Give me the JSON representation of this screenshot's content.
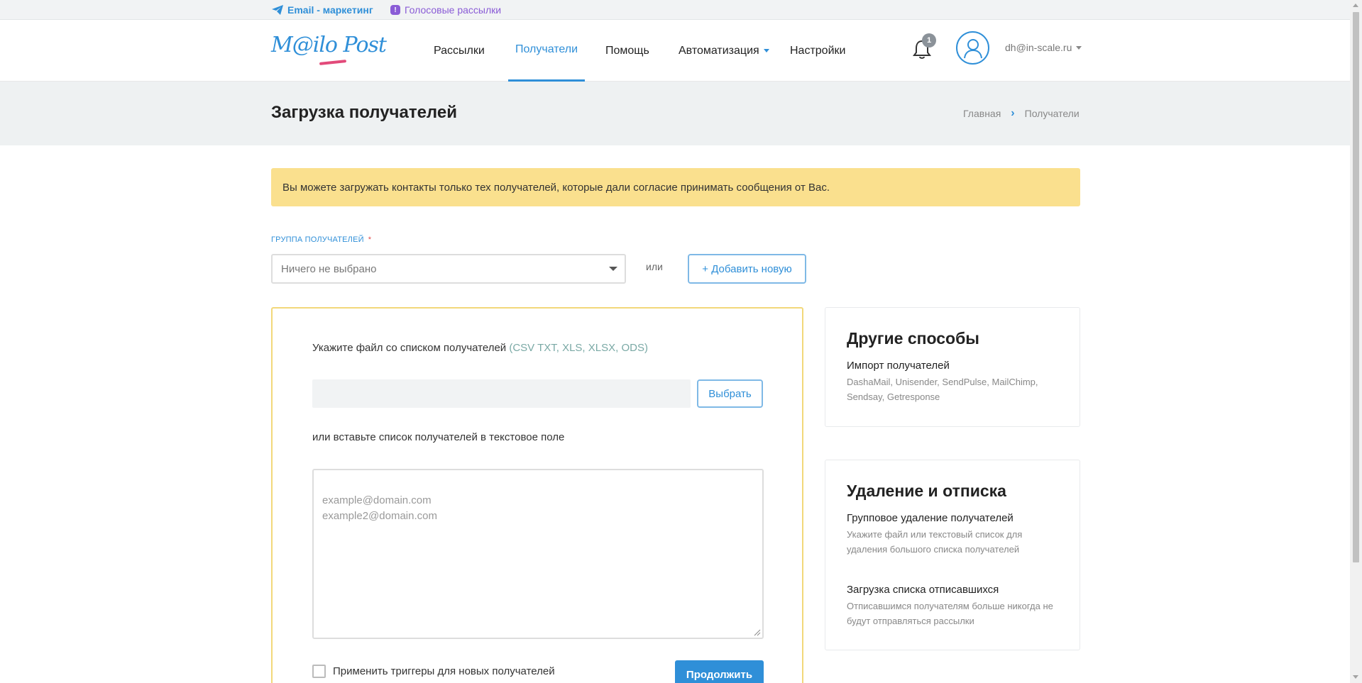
{
  "topstrip": {
    "email_label": "Email - маркетинг",
    "voice_label": "Голосовые рассылки"
  },
  "header": {
    "logo_text": "M@ilo Post",
    "nav": [
      {
        "label": "Рассылки"
      },
      {
        "label": "Получатели",
        "active": true
      },
      {
        "label": "Помощь"
      },
      {
        "label": "Автоматизация",
        "has_dropdown": true
      },
      {
        "label": "Настройки"
      }
    ],
    "notifications_count": "1",
    "user_email": "dh@in-scale.ru"
  },
  "titlebar": {
    "title": "Загрузка получателей",
    "breadcrumb": [
      "Главная",
      "Получатели"
    ]
  },
  "alert": {
    "text": "Вы можете загружать контакты только тех получателей, которые дали согласие принимать сообщения от Вас."
  },
  "group": {
    "label": "ГРУППА ПОЛУЧАТЕЛЕЙ",
    "required_mark": "*",
    "select_value": "Ничего не выбрано",
    "or_text": "или",
    "add_new_label": "+ Добавить новую"
  },
  "upload": {
    "file_label": "Укажите файл со списком получателей",
    "file_ext": "(CSV TXT, XLS, XLSX, ODS)",
    "choose_label": "Выбрать",
    "paste_label": "или вставьте список получателей в текстовое поле",
    "textarea_placeholder": "example@domain.com\nexample2@domain.com",
    "trigger_label": "Применить триггеры для новых получателей",
    "continue_label": "Продолжить"
  },
  "other_methods": {
    "title": "Другие способы",
    "import_title": "Импорт получателей",
    "import_desc": "DashaMail, Unisender, SendPulse, MailChimp, Sendsay, Getresponse"
  },
  "removal": {
    "title": "Удаление и отписка",
    "bulk_title": "Групповое удаление получателей",
    "bulk_desc": "Укажите файл или текстовый список для удаления большого списка получателей",
    "unsub_title": "Загрузка списка отписавшихся",
    "unsub_desc": "Отписавшимся получателям больше никогда не будут отправляться рассылки"
  },
  "colors": {
    "accent": "#2f8fd8",
    "alert_bg": "#fae08e",
    "panel_border": "#f2d87a",
    "voice": "#8a5cd6"
  }
}
